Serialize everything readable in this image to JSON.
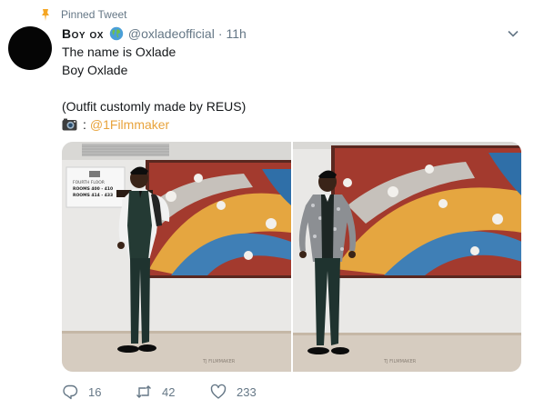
{
  "pinned": {
    "label": "Pinned Tweet",
    "icon": "pin-icon"
  },
  "author": {
    "display_name": "Boy ox",
    "badge": "globe-emoji-icon",
    "handle": "@oxladeofficial",
    "separator": "·",
    "time": "11h"
  },
  "tweet": {
    "lines": [
      "The name is Oxlade",
      "Boy Oxlade",
      "",
      "(Outfit customly made by REUS)"
    ],
    "credit_icon": "camera-icon",
    "credit_separator": ":",
    "mention": "@1Filmmaker"
  },
  "media": {
    "photos": [
      {
        "name": "photo-1",
        "sign_lines": [
          "FOURTH FLOOR",
          "ROOMS 400 - 410",
          "ROOMS 414 - 433"
        ],
        "watermark": "TJ FILMMAKER"
      },
      {
        "name": "photo-2",
        "watermark": "TJ FILMMAKER"
      }
    ]
  },
  "actions": {
    "replies": "16",
    "retweets": "42",
    "likes": "233"
  },
  "colors": {
    "accent": "#e8a33c",
    "muted": "#657786",
    "text": "#14171a"
  }
}
